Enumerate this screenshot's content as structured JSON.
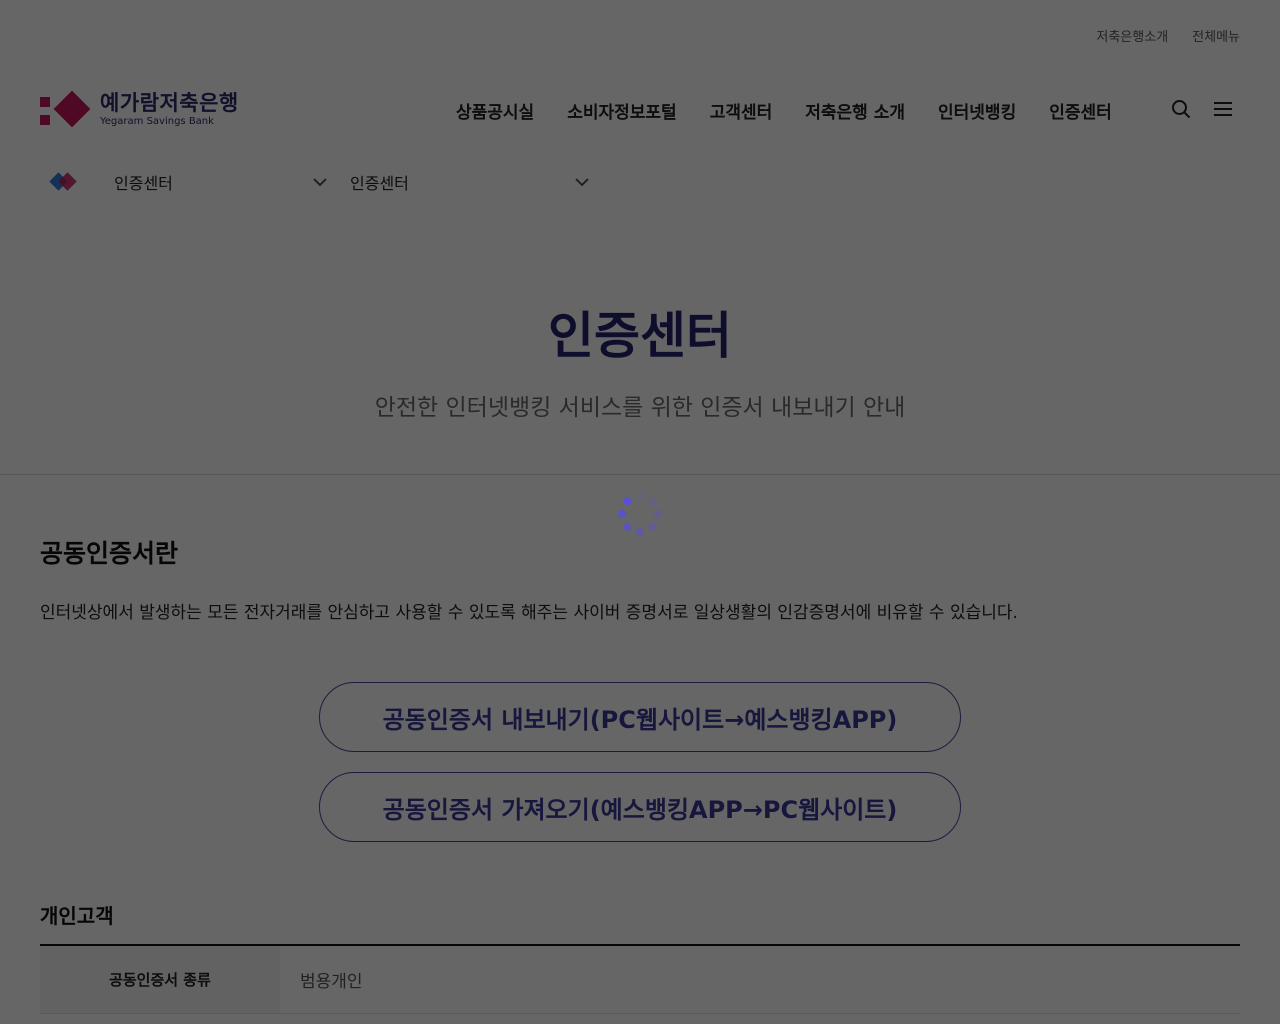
{
  "utility": {
    "items": [
      "저축은행소개",
      "전체메뉴"
    ]
  },
  "logo": {
    "name_ko": "예가람저축은행",
    "name_en": "Yegaram Savings Bank",
    "brand_color": "#c8175d"
  },
  "gnb": {
    "items": [
      "상품공시실",
      "소비자정보포털",
      "고객센터",
      "저축은행 소개",
      "인터넷뱅킹",
      "인증센터"
    ]
  },
  "subnav": {
    "depth1": "인증센터",
    "depth2": "인증센터"
  },
  "hero": {
    "title": "인증센터",
    "subtitle": "안전한 인터넷뱅킹 서비스를 위한 인증서 내보내기 안내"
  },
  "section": {
    "title": "공동인증서란",
    "description": "인터넷상에서 발생하는 모든 전자거래를 안심하고 사용할 수 있도록 해주는 사이버 증명서로 일상생활의 인감증명서에 비유할 수 있습니다."
  },
  "buttons": {
    "export": "공동인증서 내보내기(PC웹사이트→예스뱅킹APP)",
    "import": "공동인증서 가져오기(예스뱅킹APP→PC웹사이트)"
  },
  "personal": {
    "title": "개인고객",
    "rows": [
      {
        "label": "공동인증서 종류",
        "value": "범용개인"
      }
    ]
  },
  "colors": {
    "accent": "#3b3b98",
    "overlay": "rgba(0,0,0,0.6)"
  }
}
